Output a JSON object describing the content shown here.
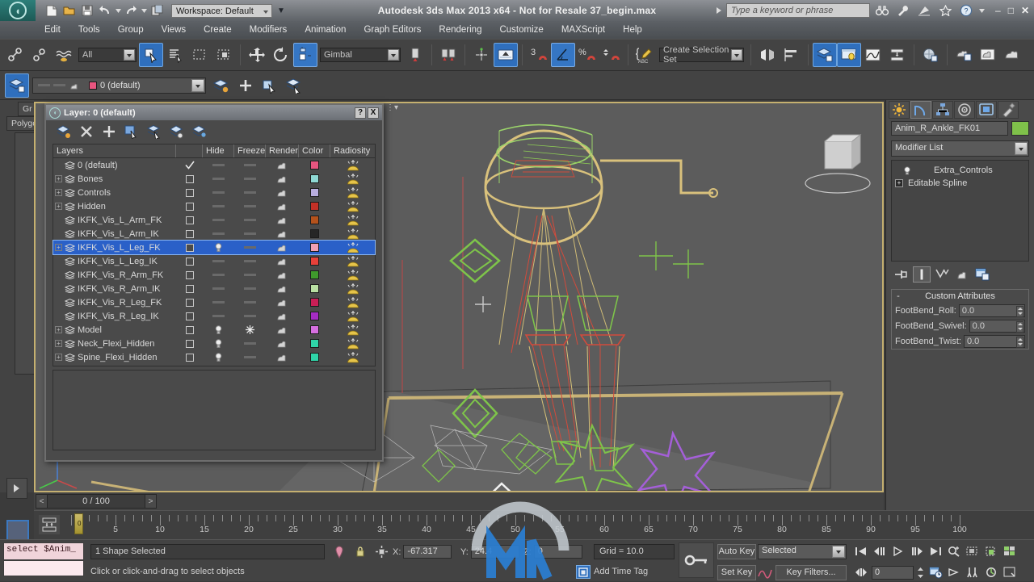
{
  "title_bar": {
    "app_title": "Autodesk 3ds Max  2013 x64  - Not for Resale    37_begin.max",
    "workspace_label": "Workspace: Default",
    "search_placeholder": "Type a keyword or phrase",
    "quick_access": [
      "new-file-icon",
      "open-file-icon",
      "save-file-icon",
      "undo-icon",
      "redo-icon",
      "set-project-folder-icon"
    ],
    "right_icons": [
      "binoculars-icon",
      "wrench-icon",
      "satellite-dish-icon",
      "star-icon",
      "help-icon"
    ],
    "window_buttons": [
      "minimize",
      "maximize",
      "close"
    ]
  },
  "menu": {
    "items": [
      "Edit",
      "Tools",
      "Group",
      "Views",
      "Create",
      "Modifiers",
      "Animation",
      "Graph Editors",
      "Rendering",
      "Customize",
      "MAXScript",
      "Help"
    ]
  },
  "toolbar": {
    "selection_filter": "All",
    "reference_coord": "Gimbal",
    "named_selection_sets": "Create Selection Set",
    "angle_snap_value": "3",
    "icons": [
      "select-link-icon",
      "unlink-icon",
      "bind-space-warp-icon",
      "select-object-icon",
      "select-by-name-icon",
      "rect-select-region-icon",
      "window-crossing-icon",
      "select-and-move-icon",
      "select-and-rotate-icon",
      "use-pivot-center-icon",
      "mirror-icon",
      "align-icon",
      "snaps-toggle-icon",
      "angle-snap-icon",
      "percent-snap-icon",
      "spinner-snap-icon",
      "named-selection-icon",
      "manage-layers-icon",
      "layer-explorer-icon",
      "curve-editor-icon",
      "schematic-view-icon",
      "material-editor-icon",
      "render-setup-icon",
      "render-frame-window-icon",
      "render-production-icon"
    ]
  },
  "layer_toolbar": {
    "current_layer": "0 (default)",
    "current_layer_color": "#e8557f",
    "buttons": [
      "layer-manager-icon",
      "create-new-layer-icon",
      "add-selection-to-layer-icon",
      "select-objects-in-layer-icon",
      "set-current-layer-icon"
    ]
  },
  "layer_dialog": {
    "title": "Layer: 0 (default)",
    "help_button": "?",
    "close_button": "X",
    "tool_icons": [
      "new-layer-icon",
      "delete-layer-icon",
      "add-layer-icon",
      "select-objects-icon",
      "select-highlight-icon",
      "highlight-selected-objects-icon",
      "hide-unselected-icon"
    ],
    "columns": [
      "Layers",
      "",
      "Hide",
      "Freeze",
      "Render",
      "Color",
      "Radiosity"
    ],
    "rows": [
      {
        "name": "0 (default)",
        "expandable": false,
        "current": true,
        "hide": "dash",
        "freeze": "dash",
        "color": "#e8557f"
      },
      {
        "name": "Bones",
        "expandable": true,
        "current": false,
        "hide": "dash",
        "freeze": "dash",
        "color": "#8fd9d4"
      },
      {
        "name": "Controls",
        "expandable": true,
        "current": false,
        "hide": "dash",
        "freeze": "dash",
        "color": "#b9aee0"
      },
      {
        "name": "Hidden",
        "expandable": true,
        "current": false,
        "hide": "dash",
        "freeze": "dash",
        "color": "#c43026"
      },
      {
        "name": "IKFK_Vis_L_Arm_FK",
        "expandable": false,
        "current": false,
        "hide": "dash",
        "freeze": "dash",
        "color": "#b4521c"
      },
      {
        "name": "IKFK_Vis_L_Arm_IK",
        "expandable": false,
        "current": false,
        "hide": "dash",
        "freeze": "dash",
        "color": "#262626"
      },
      {
        "name": "IKFK_Vis_L_Leg_FK",
        "expandable": true,
        "current": false,
        "selected": true,
        "hide": "bulb",
        "freeze": "dash",
        "color": "#f0a0b5"
      },
      {
        "name": "IKFK_Vis_L_Leg_IK",
        "expandable": false,
        "current": false,
        "hide": "dash",
        "freeze": "dash",
        "color": "#e8413a"
      },
      {
        "name": "IKFK_Vis_R_Arm_FK",
        "expandable": false,
        "current": false,
        "hide": "dash",
        "freeze": "dash",
        "color": "#3f9a2c"
      },
      {
        "name": "IKFK_Vis_R_Arm_IK",
        "expandable": false,
        "current": false,
        "hide": "dash",
        "freeze": "dash",
        "color": "#b9e0a3"
      },
      {
        "name": "IKFK_Vis_R_Leg_FK",
        "expandable": false,
        "current": false,
        "hide": "dash",
        "freeze": "dash",
        "color": "#c91f56"
      },
      {
        "name": "IKFK_Vis_R_Leg_IK",
        "expandable": false,
        "current": false,
        "hide": "dash",
        "freeze": "dash",
        "color": "#a52cc4"
      },
      {
        "name": "Model",
        "expandable": true,
        "current": false,
        "hide": "bulb",
        "freeze": "snowflake",
        "color": "#d66fe0"
      },
      {
        "name": "Neck_Flexi_Hidden",
        "expandable": true,
        "current": false,
        "hide": "bulb",
        "freeze": "dash",
        "color": "#2fd4a8"
      },
      {
        "name": "Spine_Flexi_Hidden",
        "expandable": true,
        "current": false,
        "hide": "bulb",
        "freeze": "dash",
        "color": "#2fd4a8"
      }
    ]
  },
  "behind_panels": {
    "grid_label": "Gr",
    "polygon_label": "Polygo"
  },
  "command_panel": {
    "tabs": [
      "create-tab-icon",
      "modify-tab-icon",
      "hierarchy-tab-icon",
      "motion-tab-icon",
      "display-tab-icon",
      "utilities-tab-icon"
    ],
    "active_tab_index": 1,
    "object_name": "Anim_R_Ankle_FK01",
    "object_color": "#7fc14a",
    "modifier_list_label": "Modifier List",
    "stack": [
      {
        "label": "Extra_Controls",
        "icon": "bulb-icon"
      },
      {
        "label": "Editable Spline",
        "icon": "plus-box-icon"
      }
    ],
    "stack_buttons": [
      "pin-stack-icon",
      "show-end-result-icon",
      "make-unique-icon",
      "remove-modifier-icon",
      "configure-modifier-sets-icon"
    ],
    "rollout": {
      "expander": "-",
      "title": "Custom Attributes",
      "attributes": [
        {
          "label": "FootBend_Roll:",
          "value": "0.0"
        },
        {
          "label": "FootBend_Swivel:",
          "value": "0.0"
        },
        {
          "label": "FootBend_Twist:",
          "value": "0.0"
        }
      ]
    }
  },
  "timeline": {
    "frame_field": "0 / 100",
    "prev_arrow": "<",
    "next_arrow": ">",
    "slider_label": "0",
    "ruler_labels": [
      "5",
      "10",
      "15",
      "20",
      "25",
      "30",
      "35",
      "40",
      "45",
      "50",
      "55",
      "60",
      "65",
      "70",
      "75",
      "80",
      "85",
      "90",
      "95",
      "100"
    ],
    "range_start": 0,
    "range_end": 100
  },
  "status_bar": {
    "maxscript_listener": "select $Anim_",
    "selection_status": "1 Shape Selected",
    "prompt": "Click or click-and-drag to select objects",
    "coords": [
      {
        "axis": "X:",
        "value": "-67.317"
      },
      {
        "axis": "Y:",
        "value": "24.4"
      },
      {
        "axis": "Z:",
        "value": "0"
      }
    ],
    "grid_label": "Grid = 10.0",
    "add_time_tag": "Add Time Tag",
    "auto_key": "Auto Key",
    "set_key": "Set Key",
    "key_mode": "Selected",
    "key_filters": "Key Filters...",
    "current_frame": "0",
    "lock_icon": "lock-selection-icon",
    "pin_icon": "pin-stack-icon",
    "abs_rel_icon": "absolute-relative-mode-icon",
    "key_icon": "key-toggle-icon",
    "nav_buttons": [
      "go-to-start-icon",
      "previous-frame-icon",
      "play-animation-icon",
      "next-frame-icon",
      "go-to-end-icon",
      "zoom-region-icon",
      "zoom-extents-icon",
      "field-of-view-icon",
      "maximize-viewport-icon"
    ],
    "nav_buttons2": [
      "key-mode-toggle-icon",
      "time-configuration-icon",
      "pan-view-icon",
      "walk-through-icon",
      "arc-rotate-icon",
      "maximize-viewport-toggle-icon"
    ]
  },
  "viewport": {
    "border_color": "#c5b070",
    "background": "#5c5c5c"
  }
}
